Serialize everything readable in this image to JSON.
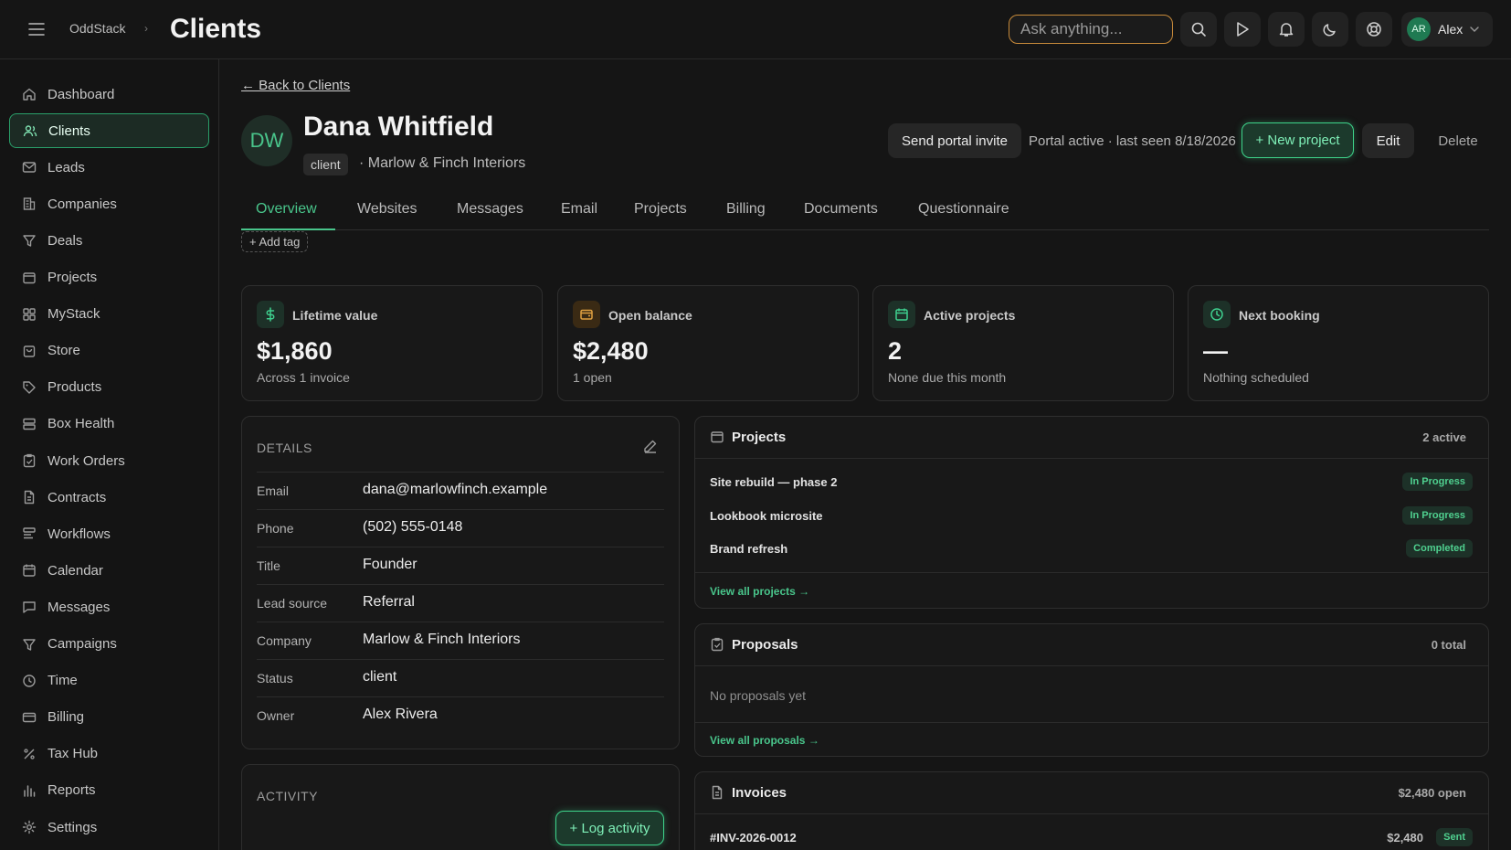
{
  "topbar": {
    "brand": "OddStack",
    "crumb_sep": "›",
    "title": "Clients",
    "search_placeholder": "Ask anything...",
    "user_initials": "AR",
    "user_name": "Alex"
  },
  "sidebar": {
    "items": [
      {
        "label": "Dashboard",
        "icon": "home-icon"
      },
      {
        "label": "Clients",
        "icon": "users-icon",
        "active": true
      },
      {
        "label": "Leads",
        "icon": "mail-icon"
      },
      {
        "label": "Companies",
        "icon": "building-icon"
      },
      {
        "label": "Deals",
        "icon": "filter-icon"
      },
      {
        "label": "Projects",
        "icon": "folder-icon"
      },
      {
        "label": "MyStack",
        "icon": "grid-icon"
      },
      {
        "label": "Store",
        "icon": "store-icon"
      },
      {
        "label": "Products",
        "icon": "tag-icon"
      },
      {
        "label": "Box Health",
        "icon": "server-icon"
      },
      {
        "label": "Work Orders",
        "icon": "clipboard-icon"
      },
      {
        "label": "Contracts",
        "icon": "file-icon"
      },
      {
        "label": "Workflows",
        "icon": "workflow-icon"
      },
      {
        "label": "Calendar",
        "icon": "calendar-icon"
      },
      {
        "label": "Messages",
        "icon": "message-icon"
      },
      {
        "label": "Campaigns",
        "icon": "funnel-icon"
      },
      {
        "label": "Time",
        "icon": "clock-icon"
      },
      {
        "label": "Billing",
        "icon": "card-icon"
      },
      {
        "label": "Tax Hub",
        "icon": "percent-icon"
      },
      {
        "label": "Reports",
        "icon": "bar-chart-icon"
      },
      {
        "label": "Settings",
        "icon": "gear-icon"
      }
    ]
  },
  "client": {
    "back_label": "← Back to Clients",
    "initials": "DW",
    "name": "Dana Whitfield",
    "tag": "client",
    "company_line": "· Marlow & Finch Interiors",
    "portal_invite_label": "Send portal invite",
    "portal_status": "Portal active · last seen 8/18/2026",
    "new_project_label": "+ New project",
    "edit_label": "Edit",
    "delete_label": "Delete",
    "add_tag_label": "+ Add tag"
  },
  "tabs": [
    "Overview",
    "Websites",
    "Messages",
    "Email",
    "Projects",
    "Billing",
    "Documents",
    "Questionnaire"
  ],
  "stats": [
    {
      "label": "Lifetime value",
      "value": "$1,860",
      "sub": "Across 1 invoice",
      "icon": "dollar-icon",
      "color": "#3ecf8e"
    },
    {
      "label": "Open balance",
      "value": "$2,480",
      "sub": "1 open",
      "icon": "wallet-icon",
      "color": "#e0a040"
    },
    {
      "label": "Active projects",
      "value": "2",
      "sub": "None due this month",
      "icon": "calendar-icon",
      "color": "#3ecf8e"
    },
    {
      "label": "Next booking",
      "value": "—",
      "sub": "Nothing scheduled",
      "icon": "clock-icon",
      "color": "#3ecf8e"
    }
  ],
  "details": {
    "heading": "DETAILS",
    "rows": [
      {
        "key": "Email",
        "value": "dana@marlowfinch.example"
      },
      {
        "key": "Phone",
        "value": "(502) 555-0148"
      },
      {
        "key": "Title",
        "value": "Founder"
      },
      {
        "key": "Lead source",
        "value": "Referral"
      },
      {
        "key": "Company",
        "value": "Marlow & Finch Interiors"
      },
      {
        "key": "Status",
        "value": "client"
      },
      {
        "key": "Owner",
        "value": "Alex Rivera"
      }
    ]
  },
  "activity": {
    "heading": "ACTIVITY",
    "log_label": "+ Log activity"
  },
  "projects_panel": {
    "title": "Projects",
    "meta": "2 active",
    "rows": [
      {
        "name": "Site rebuild — phase 2",
        "status": "In Progress"
      },
      {
        "name": "Lookbook microsite",
        "status": "In Progress"
      },
      {
        "name": "Brand refresh",
        "status": "Completed"
      }
    ],
    "link": "View all projects →"
  },
  "proposals_panel": {
    "title": "Proposals",
    "meta": "0 total",
    "empty": "No proposals yet",
    "link": "View all proposals →"
  },
  "invoices_panel": {
    "title": "Invoices",
    "meta": "$2,480 open",
    "rows": [
      {
        "number": "#INV-2026-0012",
        "amount": "$2,480",
        "status": "Sent"
      }
    ]
  }
}
